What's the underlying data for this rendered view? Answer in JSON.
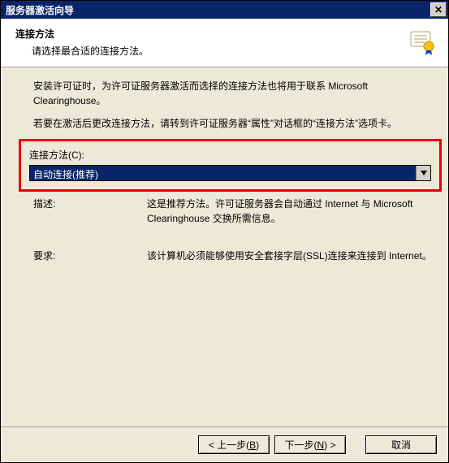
{
  "window": {
    "title": "服务器激活向导"
  },
  "header": {
    "title": "连接方法",
    "subtitle": "请选择最合适的连接方法。"
  },
  "body": {
    "para1": "安装许可证时，为许可证服务器激活而选择的连接方法也将用于联系 Microsoft Clearinghouse。",
    "para2": "若要在激活后更改连接方法，请转到许可证服务器“属性”对话框的“连接方法”选项卡。",
    "field_label": "连接方法(C):",
    "combo_value": "自动连接(推荐)",
    "desc_label": "描述:",
    "desc_value": "这是推荐方法。许可证服务器会自动通过 Internet 与 Microsoft Clearinghouse 交换所需信息。",
    "req_label": "要求:",
    "req_value": "该计算机必须能够使用安全套接字层(SSL)连接来连接到 Internet。"
  },
  "footer": {
    "back": "< 上一步(B)",
    "next": "下一步(N) >",
    "cancel": "取消"
  },
  "icons": {
    "close": "close-icon",
    "dropdown": "chevron-down-icon",
    "cert": "certificate-icon"
  }
}
